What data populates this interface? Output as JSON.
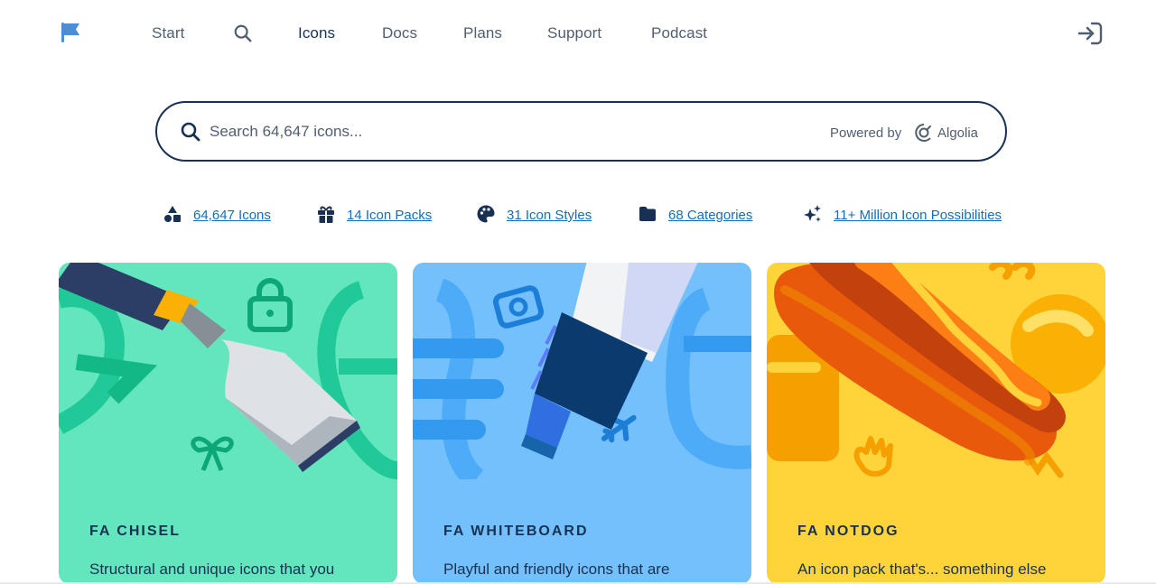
{
  "nav": {
    "logo_icon": "flag-icon",
    "items": [
      {
        "label": "Start"
      },
      {
        "label": "Icons"
      },
      {
        "label": "Docs"
      },
      {
        "label": "Plans"
      },
      {
        "label": "Support"
      },
      {
        "label": "Podcast"
      }
    ],
    "active": "Icons",
    "search_icon": "search-icon",
    "signin_icon": "sign-in-icon"
  },
  "search": {
    "placeholder": "Search 64,647 icons...",
    "powered_by": "Powered by",
    "provider": "Algolia"
  },
  "stats": [
    {
      "icon": "shapes-icon",
      "label": "64,647 Icons"
    },
    {
      "icon": "gift-icon",
      "label": "14 Icon Packs"
    },
    {
      "icon": "palette-icon",
      "label": "31 Icon Styles"
    },
    {
      "icon": "folder-icon",
      "label": "68 Categories"
    },
    {
      "icon": "sparkles-icon",
      "label": "11+ Million Icon Possibilities"
    }
  ],
  "cards": [
    {
      "name": "FA CHISEL",
      "desc": "Structural and unique icons that you",
      "color": "#63e6be"
    },
    {
      "name": "FA WHITEBOARD",
      "desc": "Playful and friendly icons that are",
      "color": "#74c0fc"
    },
    {
      "name": "FA NOTDOG",
      "desc": "An icon pack that's... something else",
      "color": "#ffd43b"
    }
  ],
  "colors": {
    "text": "#183153",
    "link": "#146ebe",
    "accent": "#146ebe"
  }
}
